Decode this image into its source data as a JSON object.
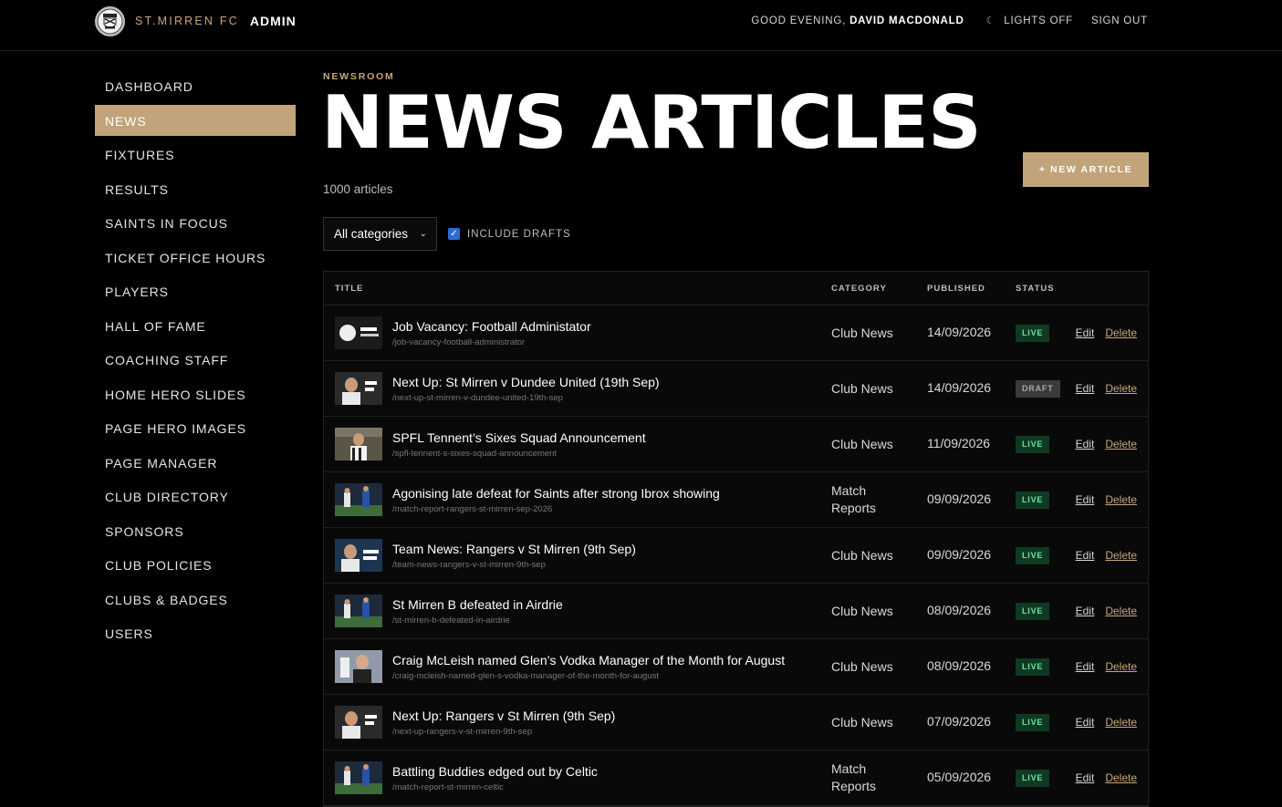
{
  "header": {
    "brand": "ST.MIRREN FC",
    "admin_label": "ADMIN",
    "greeting_prefix": "GOOD EVENING,",
    "user_name": "DAVID MACDONALD",
    "lights_label": "LIGHTS OFF",
    "signout_label": "SIGN OUT"
  },
  "sidebar": {
    "items": [
      {
        "label": "DASHBOARD",
        "active": false
      },
      {
        "label": "NEWS",
        "active": true
      },
      {
        "label": "FIXTURES",
        "active": false
      },
      {
        "label": "RESULTS",
        "active": false
      },
      {
        "label": "SAINTS IN FOCUS",
        "active": false
      },
      {
        "label": "TICKET OFFICE HOURS",
        "active": false
      },
      {
        "label": "PLAYERS",
        "active": false
      },
      {
        "label": "HALL OF FAME",
        "active": false
      },
      {
        "label": "COACHING STAFF",
        "active": false
      },
      {
        "label": "HOME HERO SLIDES",
        "active": false
      },
      {
        "label": "PAGE HERO IMAGES",
        "active": false
      },
      {
        "label": "PAGE MANAGER",
        "active": false
      },
      {
        "label": "CLUB DIRECTORY",
        "active": false
      },
      {
        "label": "SPONSORS",
        "active": false
      },
      {
        "label": "CLUB POLICIES",
        "active": false
      },
      {
        "label": "CLUBS & BADGES",
        "active": false
      },
      {
        "label": "USERS",
        "active": false
      }
    ]
  },
  "page": {
    "eyebrow": "NEWSROOM",
    "title": "NEWS ARTICLES",
    "count": "1000 articles",
    "new_button": "+ NEW ARTICLE"
  },
  "filters": {
    "category_selected": "All categories",
    "include_drafts_label": "INCLUDE DRAFTS",
    "include_drafts_checked": true
  },
  "table": {
    "columns": {
      "title": "TITLE",
      "category": "CATEGORY",
      "published": "PUBLISHED",
      "status": "STATUS"
    },
    "edit_label": "Edit",
    "delete_label": "Delete",
    "rows": [
      {
        "title": "Job Vacancy: Football Administator",
        "slug": "/job-vacancy-football-administrator",
        "category": "Club News",
        "published": "14/09/2026",
        "status": "LIVE",
        "thumb": "job-vacancy-graphic"
      },
      {
        "title": "Next Up: St Mirren v Dundee United (19th Sep)",
        "slug": "/next-up-st-mirren-v-dundee-united-19th-sep",
        "category": "Club News",
        "published": "14/09/2026",
        "status": "DRAFT",
        "thumb": "next-up-graphic"
      },
      {
        "title": "SPFL Tennent’s Sixes Squad Announcement",
        "slug": "/spfl-tennent-s-sixes-squad-announcement",
        "category": "Club News",
        "published": "11/09/2026",
        "status": "LIVE",
        "thumb": "squad-photo"
      },
      {
        "title": "Agonising late defeat for Saints after strong Ibrox showing",
        "slug": "/match-report-rangers-st-mirren-sep-2026",
        "category": "Match Reports",
        "published": "09/09/2026",
        "status": "LIVE",
        "thumb": "match-photo"
      },
      {
        "title": "Team News: Rangers v St Mirren (9th Sep)",
        "slug": "/team-news-rangers-v-st-mirren-9th-sep",
        "category": "Club News",
        "published": "09/09/2026",
        "status": "LIVE",
        "thumb": "team-news-graphic"
      },
      {
        "title": "St Mirren B defeated in Airdrie",
        "slug": "/st-mirren-b-defeated-in-airdrie",
        "category": "Club News",
        "published": "08/09/2026",
        "status": "LIVE",
        "thumb": "match-photo"
      },
      {
        "title": "Craig McLeish named Glen’s Vodka Manager of the Month for August",
        "slug": "/craig-mcleish-named-glen-s-vodka-manager-of-the-month-for-august",
        "category": "Club News",
        "published": "08/09/2026",
        "status": "LIVE",
        "thumb": "award-photo"
      },
      {
        "title": "Next Up: Rangers v St Mirren (9th Sep)",
        "slug": "/next-up-rangers-v-st-mirren-9th-sep",
        "category": "Club News",
        "published": "07/09/2026",
        "status": "LIVE",
        "thumb": "next-up-graphic"
      },
      {
        "title": "Battling Buddies edged out by Celtic",
        "slug": "/match-report-st-mirren-celtic",
        "category": "Match Reports",
        "published": "05/09/2026",
        "status": "LIVE",
        "thumb": "match-photo"
      }
    ]
  },
  "colors": {
    "accent": "#c2a47a",
    "background": "#000000",
    "live_bg": "#0f3a22",
    "live_text": "#6fe0a0",
    "draft_bg": "#3a3a3a"
  }
}
